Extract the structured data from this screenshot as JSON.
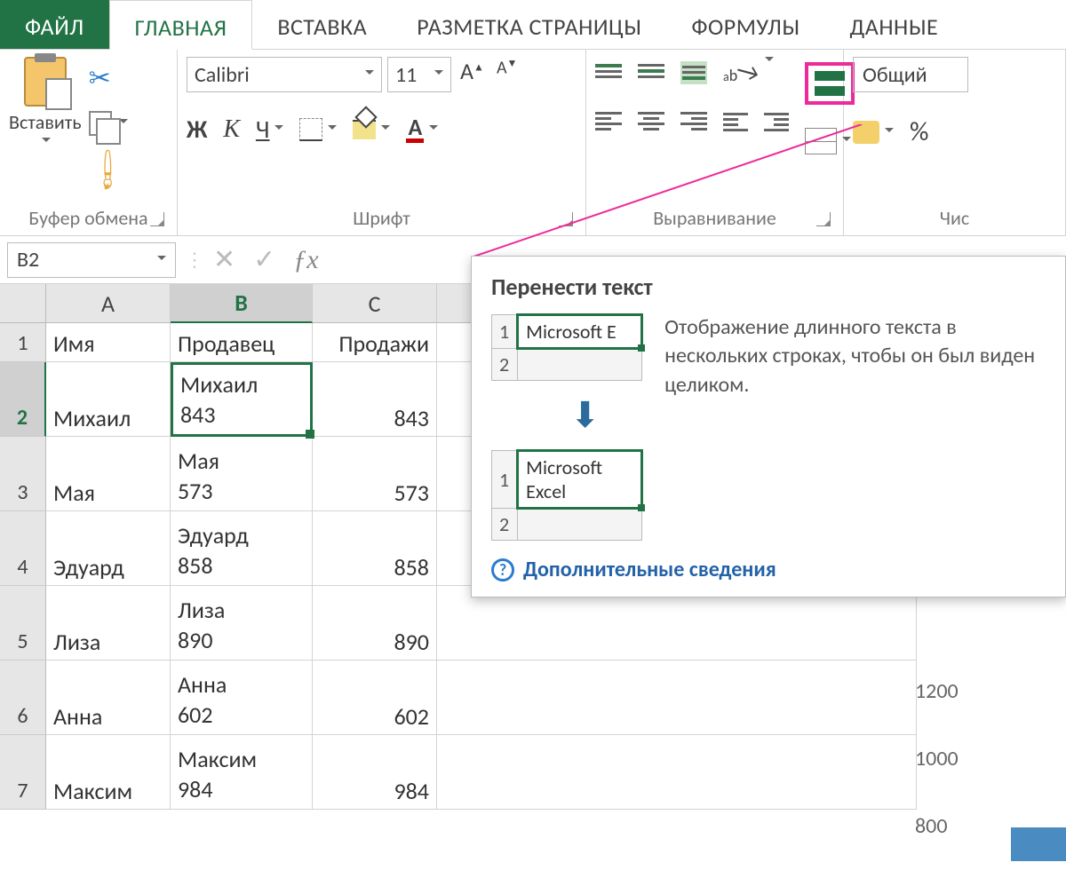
{
  "tabs": {
    "file": "ФАЙЛ",
    "home": "ГЛАВНАЯ",
    "insert": "ВСТАВКА",
    "layout": "РАЗМЕТКА СТРАНИЦЫ",
    "formulas": "ФОРМУЛЫ",
    "data": "ДАННЫЕ"
  },
  "ribbon": {
    "paste_label": "Вставить",
    "clipboard_group": "Буфер обмена",
    "font_name": "Calibri",
    "font_size": "11",
    "font_group": "Шрифт",
    "bold": "Ж",
    "italic": "К",
    "underline": "Ч",
    "fontcolor_letter": "А",
    "align_group": "Выравнивание",
    "number_format": "Общий",
    "number_group": "Чис",
    "percent": "%"
  },
  "namebox": "B2",
  "columns": {
    "a": "A",
    "b": "B",
    "c": "C"
  },
  "rows": [
    {
      "n": "1",
      "h": 44,
      "a": "Имя",
      "b": "Продавец",
      "c": "Продажи"
    },
    {
      "n": "2",
      "h": 84,
      "a": "Михаил",
      "b": "Михаил\n843",
      "c": "843"
    },
    {
      "n": "3",
      "h": 84,
      "a": "Мая",
      "b": "Мая\n573",
      "c": "573"
    },
    {
      "n": "4",
      "h": 84,
      "a": "Эдуард",
      "b": "Эдуард\n858",
      "c": "858"
    },
    {
      "n": "5",
      "h": 84,
      "a": "Лиза",
      "b": "Лиза\n890",
      "c": "890"
    },
    {
      "n": "6",
      "h": 84,
      "a": "Анна",
      "b": "Анна\n602",
      "c": "602"
    },
    {
      "n": "7",
      "h": 84,
      "a": "Максим",
      "b": "Максим\n984",
      "c": "984"
    }
  ],
  "tooltip": {
    "title": "Перенести текст",
    "illus_before": "Microsoft E",
    "illus_after": "Microsoft\nExcel",
    "r1": "1",
    "r2": "2",
    "description": "Отображение длинного текста в нескольких строках, чтобы он был виден целиком.",
    "help": "Дополнительные сведения"
  },
  "chart_data": {
    "type": "bar",
    "partial_y_ticks": [
      1200,
      1000,
      800
    ]
  }
}
